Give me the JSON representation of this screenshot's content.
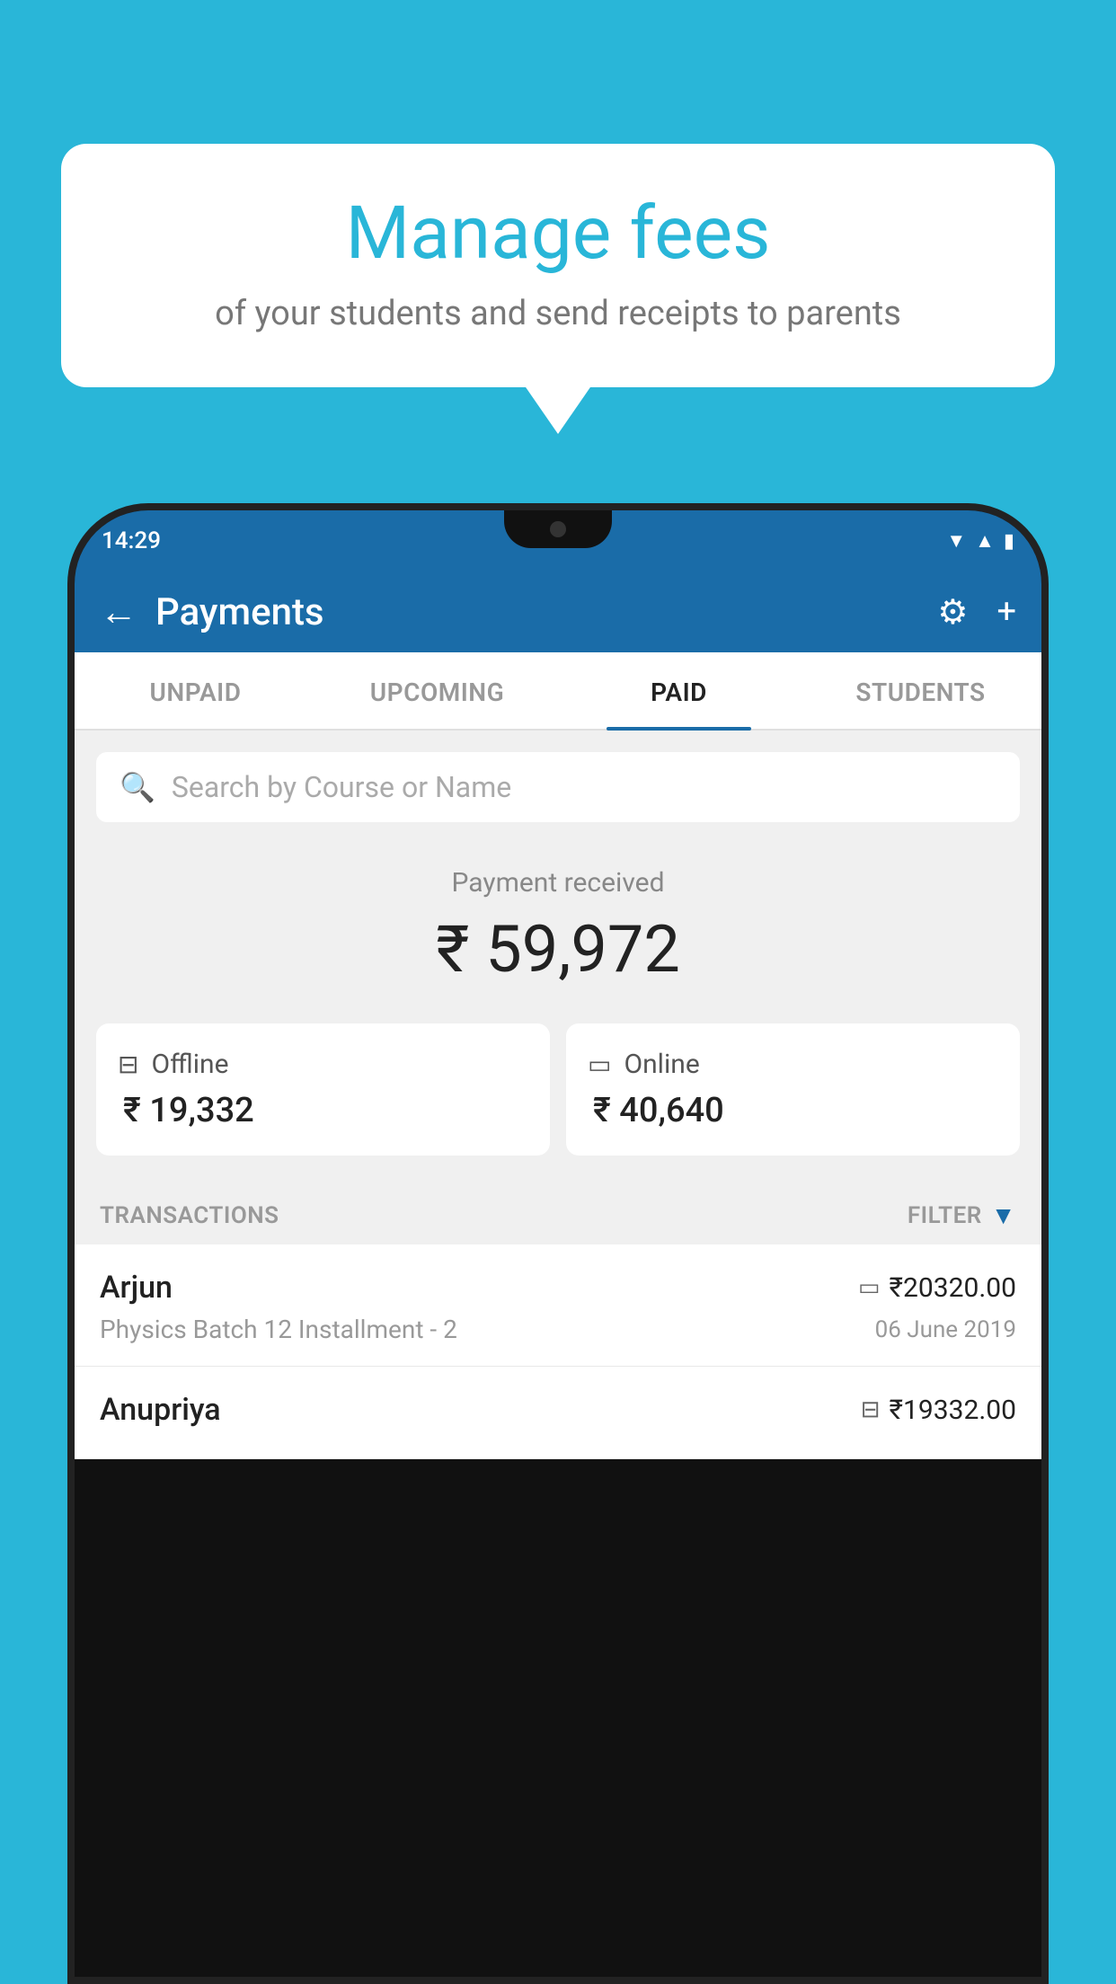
{
  "background_color": "#29B6D8",
  "bubble": {
    "title": "Manage fees",
    "subtitle": "of your students and send receipts to parents"
  },
  "phone": {
    "status_bar": {
      "time": "14:29",
      "icons": [
        "wifi",
        "signal",
        "battery"
      ]
    },
    "header": {
      "title": "Payments",
      "back_label": "←",
      "settings_label": "⚙",
      "add_label": "+"
    },
    "tabs": [
      {
        "label": "UNPAID",
        "active": false
      },
      {
        "label": "UPCOMING",
        "active": false
      },
      {
        "label": "PAID",
        "active": true
      },
      {
        "label": "STUDENTS",
        "active": false
      }
    ],
    "search": {
      "placeholder": "Search by Course or Name"
    },
    "payment_received": {
      "label": "Payment received",
      "amount": "₹ 59,972"
    },
    "cards": [
      {
        "label": "Offline",
        "amount": "₹ 19,332",
        "icon": "offline"
      },
      {
        "label": "Online",
        "amount": "₹ 40,640",
        "icon": "online"
      }
    ],
    "transactions_label": "TRANSACTIONS",
    "filter_label": "FILTER",
    "transactions": [
      {
        "name": "Arjun",
        "course": "Physics Batch 12 Installment - 2",
        "amount": "₹20320.00",
        "date": "06 June 2019",
        "type": "online"
      },
      {
        "name": "Anupriya",
        "course": "",
        "amount": "₹19332.00",
        "date": "",
        "type": "offline"
      }
    ]
  }
}
